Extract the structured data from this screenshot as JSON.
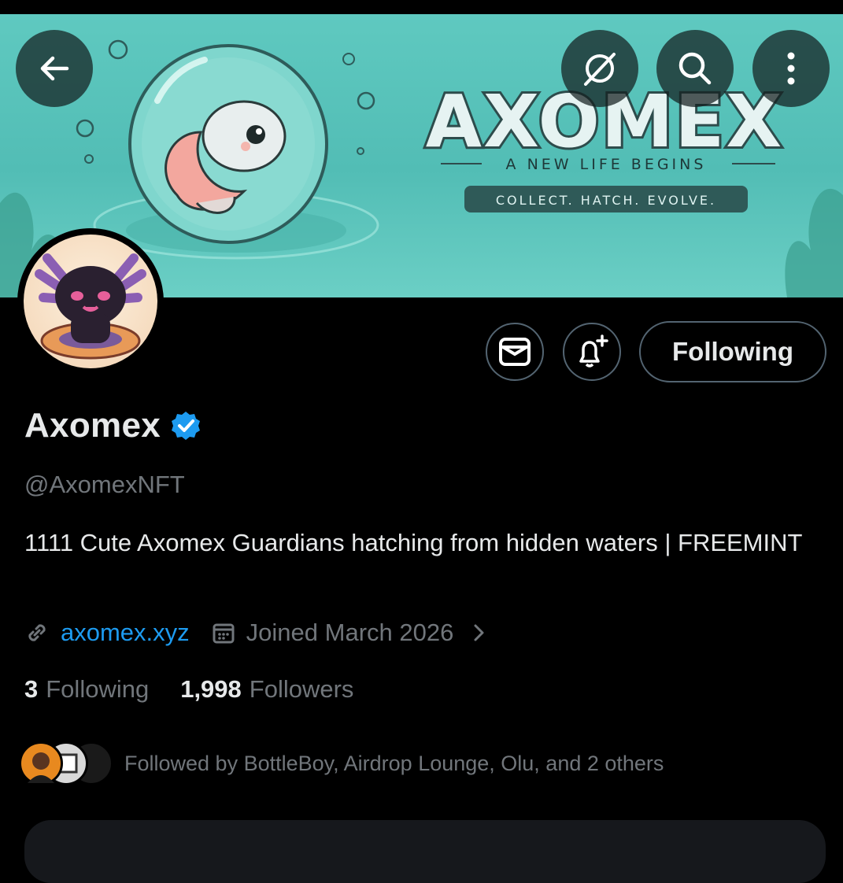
{
  "header": {
    "back_icon": "arrow-left-icon",
    "actions": [
      "grok-icon",
      "search-icon",
      "more-vertical-icon"
    ]
  },
  "banner": {
    "title": "AXOMEX",
    "tagline": "A NEW LIFE BEGINS",
    "slogan": "COLLECT. HATCH. EVOLVE."
  },
  "profile": {
    "name": "Axomex",
    "handle": "@AxomexNFT",
    "bio": "1111 Cute Axomex Guardians hatching from hidden waters | FREEMINT",
    "website": "axomex.xyz",
    "joined": "Joined March 2026",
    "following_count": "3",
    "following_label": "Following",
    "followers_count": "1,998",
    "followers_label": "Followers",
    "followed_by": "Followed by BottleBoy, Airdrop Lounge, Olu, and 2 others"
  },
  "actions": {
    "follow_button": "Following"
  },
  "colors": {
    "background": "#000000",
    "text_primary": "#e7e9ea",
    "text_secondary": "#71767b",
    "link": "#1d9bf0",
    "border": "#536471",
    "verified": "#1d9bf0",
    "banner_teal": "#5fc9c0"
  }
}
